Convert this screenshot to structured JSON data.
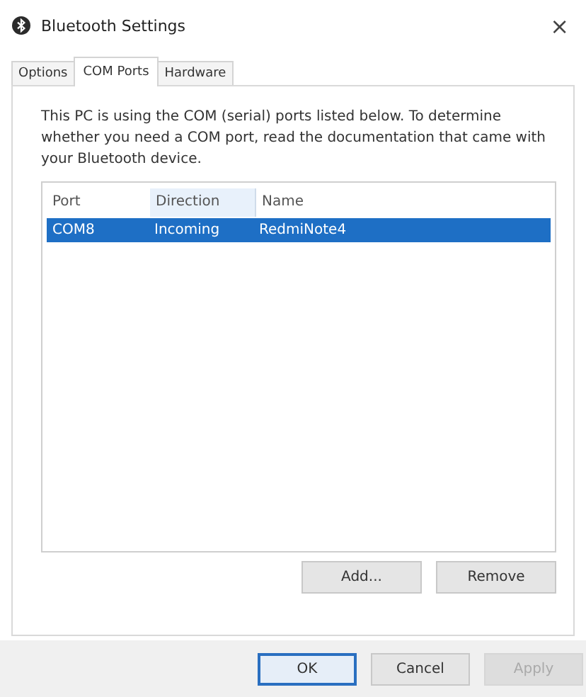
{
  "window": {
    "title": "Bluetooth Settings",
    "close": "×"
  },
  "tabs": [
    {
      "label": "Options",
      "selected": false
    },
    {
      "label": "COM Ports",
      "selected": true
    },
    {
      "label": "Hardware",
      "selected": false
    }
  ],
  "description": "This PC is using the COM (serial) ports listed below. To determine whether you need a COM port, read the documentation that came with your Bluetooth device.",
  "table": {
    "columns": [
      {
        "label": "Port",
        "hovered": false
      },
      {
        "label": "Direction",
        "hovered": true
      },
      {
        "label": "Name",
        "hovered": false
      }
    ],
    "rows": [
      {
        "cells": [
          "COM8",
          "Incoming",
          "RedmiNote4"
        ],
        "selected": true
      }
    ]
  },
  "list_buttons": [
    {
      "label": "Add...",
      "disabled": false
    },
    {
      "label": "Remove",
      "disabled": false
    }
  ],
  "dialog_buttons": [
    {
      "label": "OK",
      "default": true,
      "disabled": false
    },
    {
      "label": "Cancel",
      "default": false,
      "disabled": false
    },
    {
      "label": "Apply",
      "default": false,
      "disabled": true
    }
  ]
}
